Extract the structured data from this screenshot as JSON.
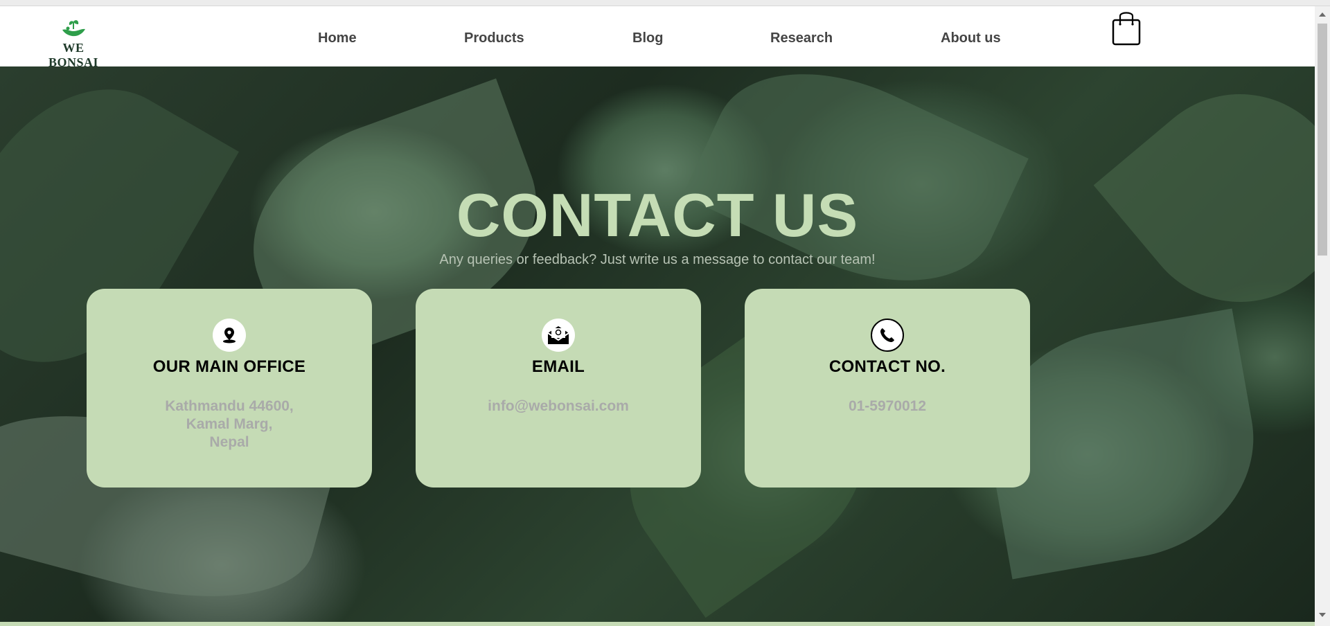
{
  "brand": {
    "name": "WE BONSAI",
    "logo_icon": "bonsai-hand-icon",
    "accent": "#2e9e4a"
  },
  "nav": {
    "items": [
      {
        "label": "Home"
      },
      {
        "label": "Products"
      },
      {
        "label": "Blog"
      },
      {
        "label": "Research"
      },
      {
        "label": "About us"
      }
    ],
    "cart_icon": "shopping-bag-icon"
  },
  "hero": {
    "title": "CONTACT US",
    "subtitle": "Any queries or feedback? Just write us a message to contact our team!",
    "title_color": "#c5ddb5"
  },
  "cards": [
    {
      "icon": "location-pin-icon",
      "heading": "OUR MAIN OFFICE",
      "value": "Kathmandu 44600,\nKamal Marg,\nNepal"
    },
    {
      "icon": "email-envelope-icon",
      "heading": "EMAIL",
      "value": "info@webonsai.com"
    },
    {
      "icon": "phone-icon",
      "heading": "CONTACT NO.",
      "value": "01-5970012"
    }
  ],
  "colors": {
    "card_bg": "#c5dbb5",
    "card_value": "#a9aaa9"
  }
}
